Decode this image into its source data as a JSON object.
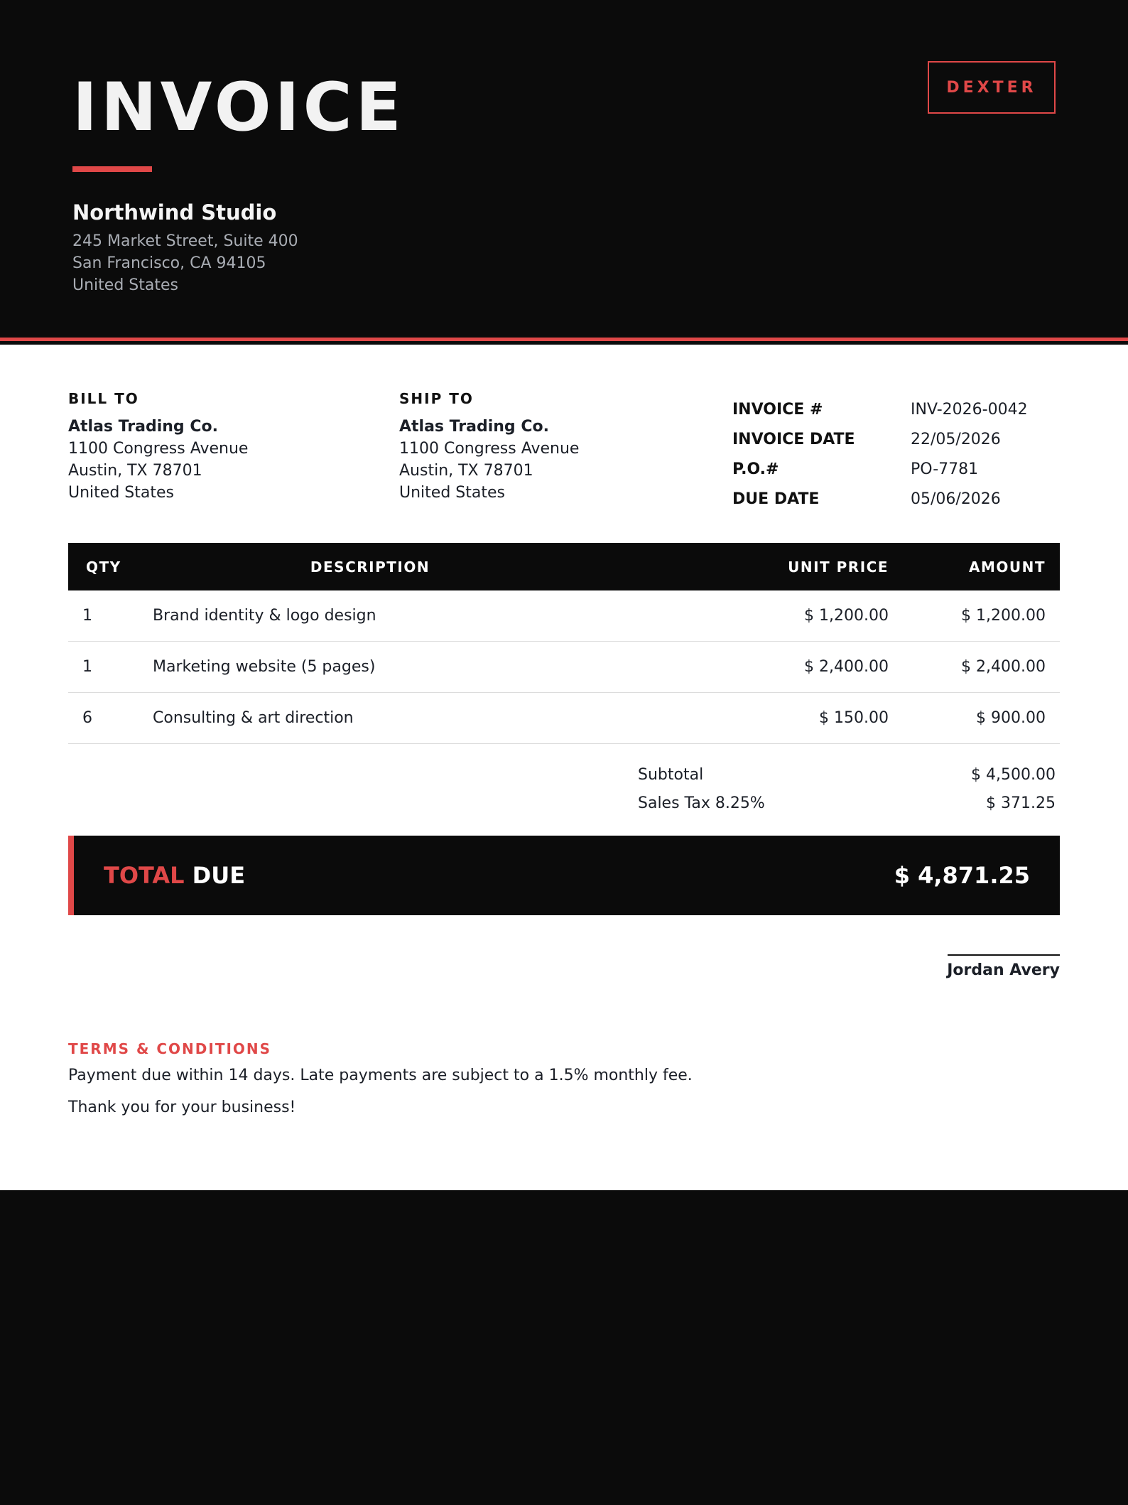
{
  "header": {
    "title": "INVOICE",
    "brand": "DEXTER",
    "company": {
      "name": "Northwind Studio",
      "address": [
        "245 Market Street, Suite 400",
        "San Francisco, CA 94105",
        "United States"
      ]
    }
  },
  "bill_to": {
    "label": "BILL TO",
    "name": "Atlas Trading Co.",
    "address": [
      "1100 Congress Avenue",
      "Austin, TX 78701",
      "United States"
    ]
  },
  "ship_to": {
    "label": "SHIP TO",
    "name": "Atlas Trading Co.",
    "address": [
      "1100 Congress Avenue",
      "Austin, TX 78701",
      "United States"
    ]
  },
  "meta": [
    {
      "key": "INVOICE #",
      "value": "INV-2026-0042"
    },
    {
      "key": "INVOICE DATE",
      "value": "22/05/2026"
    },
    {
      "key": "P.O.#",
      "value": "PO-7781"
    },
    {
      "key": "DUE DATE",
      "value": "05/06/2026"
    }
  ],
  "table": {
    "headers": {
      "qty": "QTY",
      "description": "DESCRIPTION",
      "unit_price": "UNIT PRICE",
      "amount": "AMOUNT"
    },
    "rows": [
      {
        "qty": "1",
        "description": "Brand identity & logo design",
        "unit_price": "$ 1,200.00",
        "amount": "$ 1,200.00"
      },
      {
        "qty": "1",
        "description": "Marketing website (5 pages)",
        "unit_price": "$ 2,400.00",
        "amount": "$ 2,400.00"
      },
      {
        "qty": "6",
        "description": "Consulting & art direction",
        "unit_price": "$ 150.00",
        "amount": "$ 900.00"
      }
    ]
  },
  "totals": {
    "subtotal_label": "Subtotal",
    "subtotal": "$ 4,500.00",
    "tax_label": "Sales Tax 8.25%",
    "tax": "$ 371.25",
    "total_label_part1": "TOTAL",
    "total_label_part2": "DUE",
    "total": "$ 4,871.25"
  },
  "signature": {
    "name": "Jordan Avery"
  },
  "terms": {
    "title": "TERMS & CONDITIONS",
    "text": "Payment due within 14 days. Late payments are subject to a 1.5% monthly fee.",
    "thanks": "Thank you for your business!"
  },
  "colors": {
    "accent": "#e04848",
    "dark": "#0b0b0b",
    "text": "#1b1f27",
    "muted": "#a9adb4"
  }
}
